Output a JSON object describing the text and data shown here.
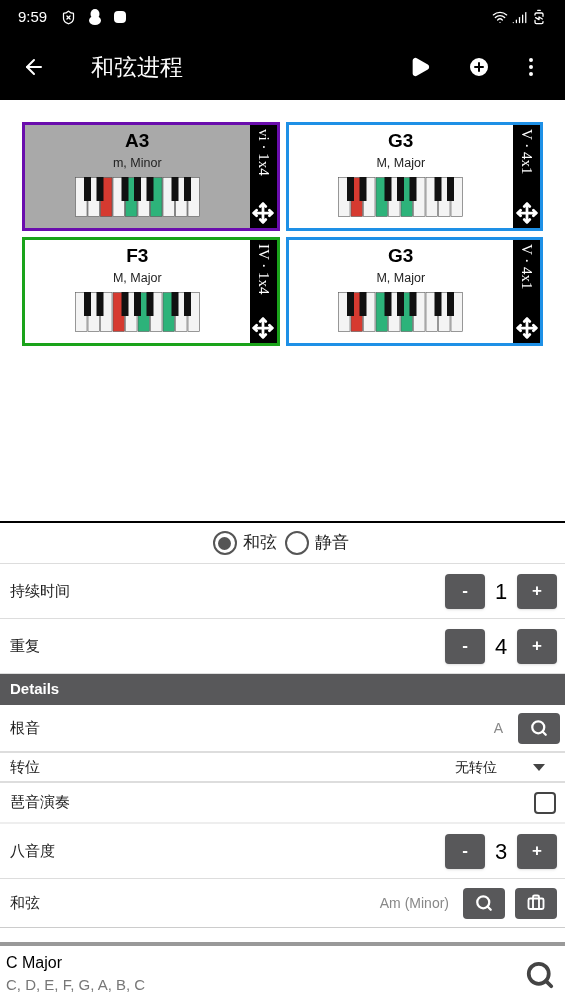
{
  "status_bar": {
    "time": "9:59"
  },
  "app_bar": {
    "title": "和弦进程"
  },
  "chords": [
    {
      "name": "A3",
      "quality": "m, Minor",
      "tag": "vi · 1x4",
      "color": "#6a0dad",
      "selected": true,
      "keys": [
        {
          "kind": "plain"
        },
        {
          "kind": "plain"
        },
        {
          "kind": "root"
        },
        {
          "kind": "plain"
        },
        {
          "kind": "tone"
        },
        {
          "kind": "plain"
        },
        {
          "kind": "tone"
        },
        {
          "kind": "plain"
        },
        {
          "kind": "plain"
        },
        {
          "kind": "plain"
        }
      ]
    },
    {
      "name": "G3",
      "quality": "M, Major",
      "tag": "V · 4x1",
      "color": "#1e90e6",
      "selected": false,
      "keys": [
        {
          "kind": "plain"
        },
        {
          "kind": "root"
        },
        {
          "kind": "plain"
        },
        {
          "kind": "tone"
        },
        {
          "kind": "plain"
        },
        {
          "kind": "tone"
        },
        {
          "kind": "plain"
        },
        {
          "kind": "plain"
        },
        {
          "kind": "plain"
        },
        {
          "kind": "plain"
        }
      ]
    },
    {
      "name": "F3",
      "quality": "M, Major",
      "tag": "IV · 1x4",
      "color": "#1aa31a",
      "selected": false,
      "keys": [
        {
          "kind": "plain"
        },
        {
          "kind": "plain"
        },
        {
          "kind": "plain"
        },
        {
          "kind": "root"
        },
        {
          "kind": "plain"
        },
        {
          "kind": "tone"
        },
        {
          "kind": "plain"
        },
        {
          "kind": "tone"
        },
        {
          "kind": "plain"
        },
        {
          "kind": "plain"
        }
      ]
    },
    {
      "name": "G3",
      "quality": "M, Major",
      "tag": "V · 4x1",
      "color": "#1e90e6",
      "selected": false,
      "keys": [
        {
          "kind": "plain"
        },
        {
          "kind": "root"
        },
        {
          "kind": "plain"
        },
        {
          "kind": "tone"
        },
        {
          "kind": "plain"
        },
        {
          "kind": "tone"
        },
        {
          "kind": "plain"
        },
        {
          "kind": "plain"
        },
        {
          "kind": "plain"
        },
        {
          "kind": "plain"
        }
      ]
    }
  ],
  "mode": [
    {
      "label": "和弦",
      "selected": true
    },
    {
      "label": "静音",
      "selected": false
    }
  ],
  "settings": [
    {
      "kind": "stepper",
      "label": "持续时间",
      "value": "1",
      "minus": "-",
      "plus": "+"
    },
    {
      "kind": "stepper",
      "label": "重复",
      "value": "4",
      "minus": "-",
      "plus": "+"
    }
  ],
  "details": {
    "title": "Details",
    "rows": [
      {
        "kind": "search",
        "label": "根音",
        "value": "A"
      },
      {
        "kind": "dropdown",
        "label": "转位",
        "value": "无转位"
      },
      {
        "kind": "checkbox",
        "label": "琶音演奏",
        "checked": false
      },
      {
        "kind": "stepper",
        "label": "八音度",
        "value": "3",
        "minus": "-",
        "plus": "+"
      },
      {
        "kind": "chord",
        "label": "和弦",
        "value": "Am (Minor)"
      }
    ]
  },
  "scale": {
    "name": "C Major",
    "notes": "C, D, E, F, G, A, B, C"
  }
}
